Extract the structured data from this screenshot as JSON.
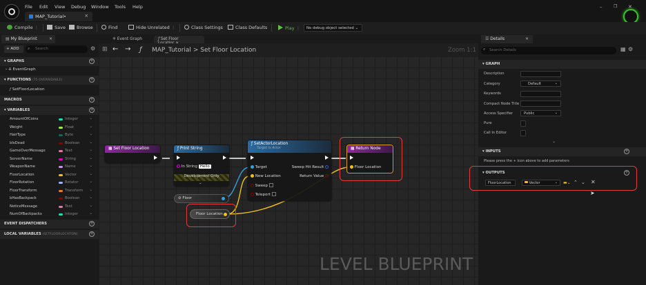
{
  "menu": [
    "File",
    "Edit",
    "View",
    "Debug",
    "Window",
    "Tools",
    "Help"
  ],
  "document_tab": "MAP_Tutorial•",
  "toolbar": {
    "compile": "Compile",
    "save": "Save",
    "browse": "Browse",
    "find": "Find",
    "hide_unrelated": "Hide Unrelated",
    "class_settings": "Class Settings",
    "class_defaults": "Class Defaults",
    "play": "Play",
    "debug_select": "No debug object selected"
  },
  "left_panel": {
    "tab": "My Blueprint",
    "add": "+ ADD",
    "search_placeholder": "Search",
    "graphs_header": "GRAPHS",
    "event_graph": "EventGraph",
    "functions_header": "FUNCTIONS",
    "functions_note": "(75 OVERRIDABLE)",
    "function_item": "SetFloorLocation",
    "macros_header": "MACROS",
    "variables_header": "VARIABLES",
    "variables": [
      {
        "name": "AmountOfCoins",
        "type": "Integer",
        "color": "#1fe0b0"
      },
      {
        "name": "Weight",
        "type": "Float",
        "color": "#a0f040"
      },
      {
        "name": "HairType",
        "type": "Byte",
        "color": "#0a6e5a"
      },
      {
        "name": "bIsDead",
        "type": "Boolean",
        "color": "#8c0000"
      },
      {
        "name": "GameOverMessage",
        "type": "Text",
        "color": "#e07aa8"
      },
      {
        "name": "ServerName",
        "type": "String",
        "color": "#e000d0"
      },
      {
        "name": "WeaponName",
        "type": "Name",
        "color": "#c890f0"
      },
      {
        "name": "FloorLocation",
        "type": "Vector",
        "color": "#f2c21c"
      },
      {
        "name": "FloorRotation",
        "type": "Rotator",
        "color": "#a0b4ff"
      },
      {
        "name": "FloorTransform",
        "type": "Transform",
        "color": "#f07a1c"
      },
      {
        "name": "bHasBackpack",
        "type": "Boolean",
        "color": "#8c0000"
      },
      {
        "name": "NoticeMessage",
        "type": "Text",
        "color": "#e07aa8"
      },
      {
        "name": "NumOfBackpacks",
        "type": "Integer",
        "color": "#1fe0b0"
      }
    ],
    "event_dispatchers_header": "EVENT DISPATCHERS",
    "local_variables_header": "LOCAL VARIABLES",
    "local_variables_note": "(SETFLOORLOCATION)"
  },
  "graph": {
    "tab_event_graph": "Event Graph",
    "tab_function": "Set Floor Locatior",
    "breadcrumb_root": "MAP_Tutorial",
    "breadcrumb_sep": ">",
    "breadcrumb_current": "Set Floor Location",
    "zoom": "Zoom 1:1",
    "watermark": "LEVEL BLUEPRINT",
    "nodes": {
      "entry": "Set Floor Location",
      "print": "Print String",
      "print_in_string": "In String",
      "print_value": "Hello",
      "dev_only": "Development Only",
      "setactor": "SetActorLocation",
      "setactor_sub": "Target is Actor",
      "target": "Target",
      "new_location": "New Location",
      "sweep": "Sweep",
      "teleport": "Teleport",
      "sweep_hit": "Sweep Hit Result",
      "return_value": "Return Value",
      "floor": "Floor",
      "floor_location": "Floor Location",
      "return_node": "Return Node",
      "return_floor_location": "Floor Location"
    }
  },
  "details": {
    "tab": "Details",
    "search_placeholder": "Search Details",
    "graph_header": "GRAPH",
    "description": "Description",
    "category": "Category",
    "category_value": "Default",
    "keywords": "Keywords",
    "compact_title": "Compact Node Title",
    "access_specifier": "Access Specifier",
    "access_value": "Public",
    "pure": "Pure",
    "call_in_editor": "Call In Editor",
    "inputs_header": "INPUTS",
    "inputs_hint": "Please press the + icon above to add parameters",
    "outputs_header": "OUTPUTS",
    "output_name": "FloorLocation",
    "output_type": "Vector"
  },
  "colors": {
    "function_header": "#7a2a8a",
    "function_call_header": "#2a5a8a",
    "exec": "#ffffff",
    "vector": "#f2c21c",
    "object": "#35a0e0",
    "highlight": "#e53b3b",
    "play": "#5bc23e"
  }
}
